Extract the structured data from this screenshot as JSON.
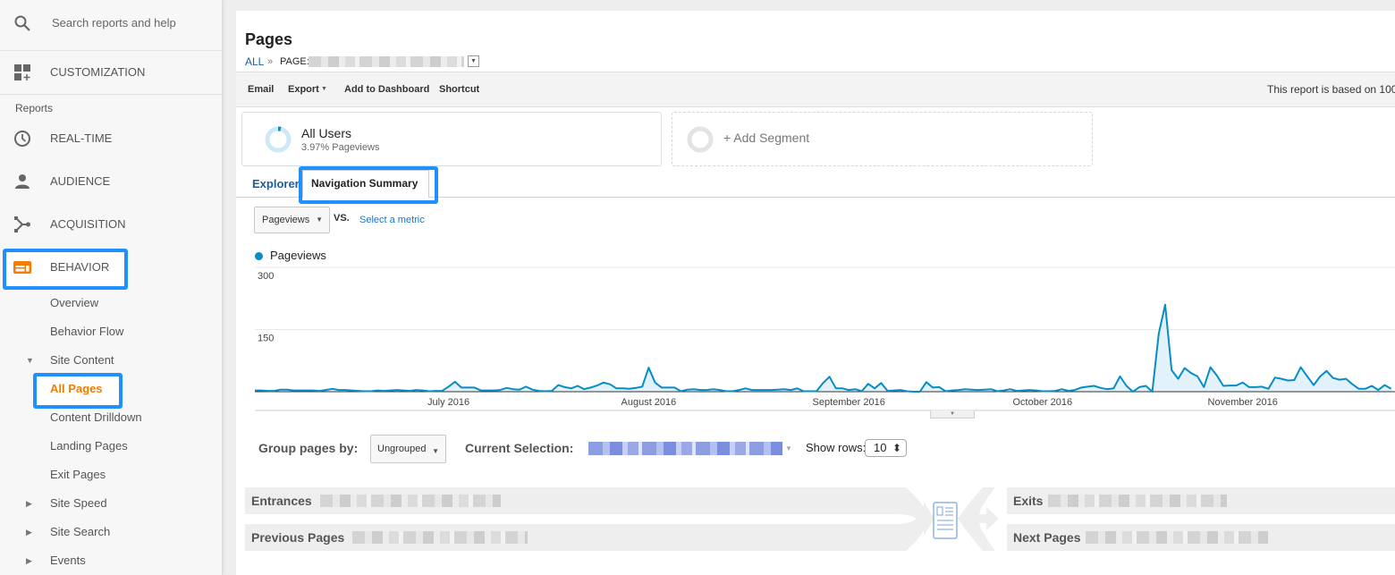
{
  "sidebar": {
    "search": {
      "placeholder": "Search reports and help",
      "icon": "search-icon"
    },
    "customization": {
      "label": "CUSTOMIZATION",
      "icon": "customization-icon"
    },
    "reports_heading": "Reports",
    "sections": [
      {
        "label": "REAL-TIME",
        "icon": "clock-icon"
      },
      {
        "label": "AUDIENCE",
        "icon": "person-icon"
      },
      {
        "label": "ACQUISITION",
        "icon": "acquisition-icon"
      },
      {
        "label": "BEHAVIOR",
        "icon": "behavior-icon",
        "expanded": true,
        "highlighted": true
      }
    ],
    "behavior_items": [
      {
        "label": "Overview"
      },
      {
        "label": "Behavior Flow"
      },
      {
        "label": "Site Content",
        "expander": "expanded",
        "expander_glyph": "▼"
      },
      {
        "label": "All Pages",
        "active": true,
        "highlighted": true
      },
      {
        "label": "Content Drilldown"
      },
      {
        "label": "Landing Pages"
      },
      {
        "label": "Exit Pages"
      },
      {
        "label": "Site Speed",
        "expander": "collapsed",
        "expander_glyph": "▶"
      },
      {
        "label": "Site Search",
        "expander": "collapsed",
        "expander_glyph": "▶"
      },
      {
        "label": "Events",
        "expander": "collapsed",
        "expander_glyph": "▶"
      }
    ]
  },
  "header": {
    "title": "Pages",
    "breadcrumb": {
      "root": "ALL",
      "separator": "»",
      "dimension_label": "PAGE:",
      "dimension_value_redacted": true,
      "dropdown_glyph": "▼"
    }
  },
  "toolbar": {
    "email": "Email",
    "export": "Export",
    "export_caret": "▼",
    "add_to_dashboard": "Add to Dashboard",
    "shortcut": "Shortcut",
    "report_note": "This report is based on 100"
  },
  "segments": {
    "active": {
      "name": "All Users",
      "detail": "3.97% Pageviews",
      "share_percent": 3.97
    },
    "add_label": "+ Add Segment"
  },
  "tabs": [
    {
      "label": "Explorer",
      "active": false
    },
    {
      "label": "Navigation Summary",
      "active": true,
      "highlighted": true
    }
  ],
  "metric_selector": {
    "primary": "Pageviews",
    "caret": "▼",
    "vs_label": "VS.",
    "secondary_placeholder": "Select a metric"
  },
  "legend": [
    {
      "label": "Pageviews",
      "color": "#058dc7"
    }
  ],
  "chart_controls": {
    "collapse_glyph": "▼"
  },
  "navigation_summary": {
    "group_by_label": "Group pages by:",
    "group_by_value": "Ungrouped",
    "group_by_caret": "▼",
    "current_selection_label": "Current Selection:",
    "current_selection_redacted": true,
    "current_selection_caret": "▼",
    "show_rows_label": "Show rows:",
    "show_rows_value": "10",
    "show_rows_spinner": "⬍",
    "blocks": {
      "entrances": "Entrances",
      "previous_pages": "Previous Pages",
      "exits": "Exits",
      "next_pages": "Next Pages"
    }
  },
  "colors": {
    "accent": "#058dc7",
    "area_fill": "#e3f2fa",
    "link": "#1a73c8",
    "orange": "#f57c00",
    "highlight": "#1e90ff"
  },
  "chart_data": {
    "type": "area",
    "title": "",
    "xlabel": "",
    "ylabel": "",
    "start_date": "2016-06-01",
    "interval": "day",
    "series": [
      {
        "name": "Pageviews",
        "color": "#058dc7",
        "values": [
          3,
          3,
          2,
          2,
          5,
          5,
          3,
          3,
          3,
          3,
          2,
          4,
          7,
          4,
          4,
          3,
          2,
          1,
          1,
          3,
          2,
          3,
          4,
          3,
          2,
          4,
          3,
          1,
          2,
          2,
          12,
          24,
          10,
          10,
          10,
          3,
          3,
          3,
          4,
          9,
          6,
          5,
          12,
          5,
          2,
          1,
          2,
          16,
          11,
          8,
          14,
          6,
          10,
          15,
          22,
          18,
          8,
          8,
          7,
          9,
          12,
          58,
          22,
          10,
          10,
          10,
          1,
          5,
          6,
          4,
          4,
          6,
          4,
          1,
          1,
          4,
          8,
          4,
          4,
          4,
          4,
          5,
          6,
          4,
          8,
          1,
          1,
          1,
          21,
          36,
          8,
          8,
          4,
          6,
          1,
          19,
          8,
          21,
          2,
          3,
          4,
          1,
          0,
          0,
          23,
          10,
          11,
          1,
          3,
          4,
          6,
          5,
          4,
          5,
          6,
          1,
          3,
          6,
          2,
          3,
          4,
          3,
          1,
          1,
          2,
          6,
          2,
          4,
          10,
          12,
          14,
          9,
          6,
          8,
          37,
          14,
          0,
          11,
          14,
          0,
          140,
          210,
          52,
          31,
          57,
          45,
          37,
          11,
          59,
          39,
          14,
          15,
          15,
          22,
          11,
          11,
          12,
          7,
          34,
          31,
          27,
          28,
          59,
          37,
          16,
          37,
          50,
          33,
          29,
          31,
          18,
          7,
          7,
          14,
          4,
          16,
          7
        ]
      }
    ],
    "x_ticks": [
      {
        "date": "2016-07-01",
        "label": "July 2016"
      },
      {
        "date": "2016-08-01",
        "label": "August 2016"
      },
      {
        "date": "2016-09-01",
        "label": "September 2016"
      },
      {
        "date": "2016-10-01",
        "label": "October 2016"
      },
      {
        "date": "2016-11-01",
        "label": "November 2016"
      }
    ],
    "y_ticks": [
      150,
      300
    ],
    "ylim": [
      0,
      300
    ],
    "grid": true,
    "legend": "top-left"
  }
}
